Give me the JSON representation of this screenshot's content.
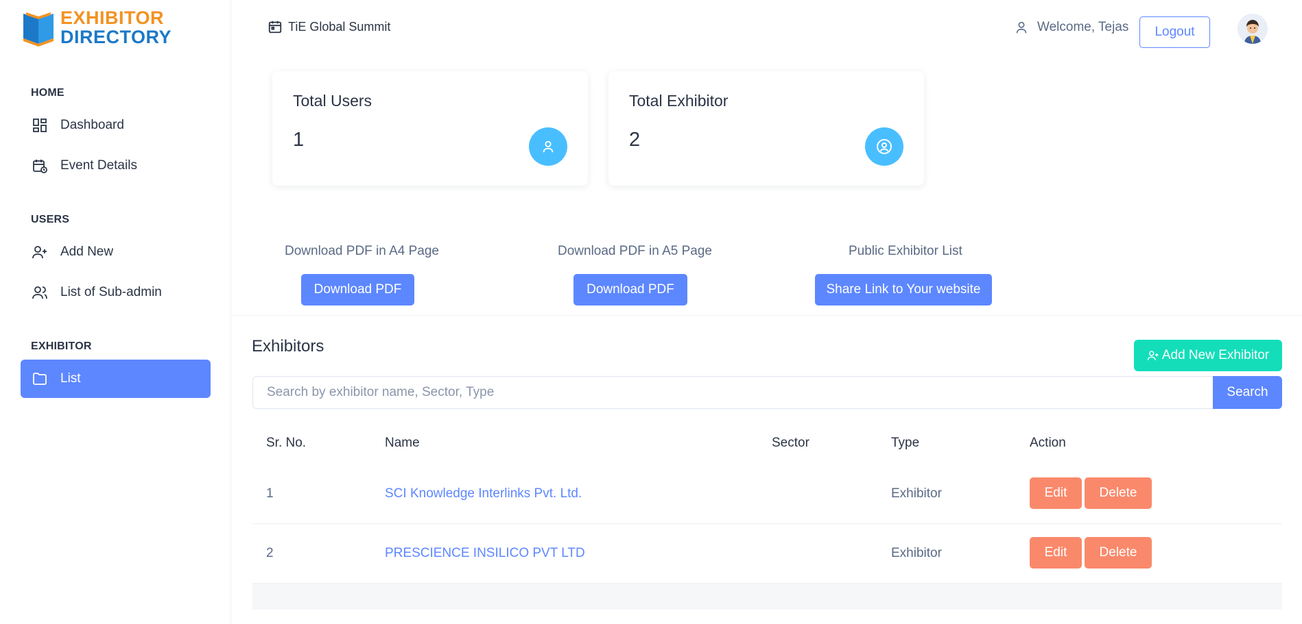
{
  "brand": {
    "line1": "EXHIBITOR",
    "line2": "DIRECTORY",
    "colors": {
      "orange": "#f39221",
      "blue": "#1b79c8"
    }
  },
  "sidebar": {
    "sections": [
      {
        "label": "HOME",
        "items": [
          {
            "label": "Dashboard",
            "icon": "dashboard-icon"
          },
          {
            "label": "Event Details",
            "icon": "calendar-clock-icon"
          }
        ]
      },
      {
        "label": "USERS",
        "items": [
          {
            "label": "Add New",
            "icon": "user-plus-icon"
          },
          {
            "label": "List of Sub-admin",
            "icon": "users-icon"
          }
        ]
      },
      {
        "label": "EXHIBITOR",
        "items": [
          {
            "label": "List",
            "icon": "folder-icon",
            "active": true
          }
        ]
      }
    ]
  },
  "header": {
    "event_name": "TiE Global Summit",
    "welcome": "Welcome, Tejas",
    "logout_label": "Logout"
  },
  "stats": [
    {
      "title": "Total Users",
      "value": "1",
      "icon": "user-icon"
    },
    {
      "title": "Total Exhibitor",
      "value": "2",
      "icon": "user-circle-icon"
    }
  ],
  "downloads": [
    {
      "caption": "Download PDF in A4 Page",
      "button": "Download PDF"
    },
    {
      "caption": "Download PDF in A5 Page",
      "button": "Download PDF"
    },
    {
      "caption": "Public Exhibitor List",
      "button": "Share Link to Your website"
    }
  ],
  "exhibitors": {
    "title": "Exhibitors",
    "add_label": "Add New Exhibitor",
    "search_placeholder": "Search by exhibitor name, Sector, Type",
    "search_label": "Search",
    "columns": [
      "Sr. No.",
      "Name",
      "Sector",
      "Type",
      "Action"
    ],
    "rows": [
      {
        "sr": "1",
        "name": "SCI Knowledge Interlinks Pvt. Ltd.",
        "sector": "",
        "type": "Exhibitor"
      },
      {
        "sr": "2",
        "name": "PRESCIENCE INSILICO PVT LTD",
        "sector": "",
        "type": "Exhibitor"
      }
    ],
    "edit_label": "Edit",
    "delete_label": "Delete"
  },
  "theme": {
    "primary": "#5d87ff",
    "success": "#13deb9",
    "danger": "#fa896b",
    "info": "#49beff"
  }
}
